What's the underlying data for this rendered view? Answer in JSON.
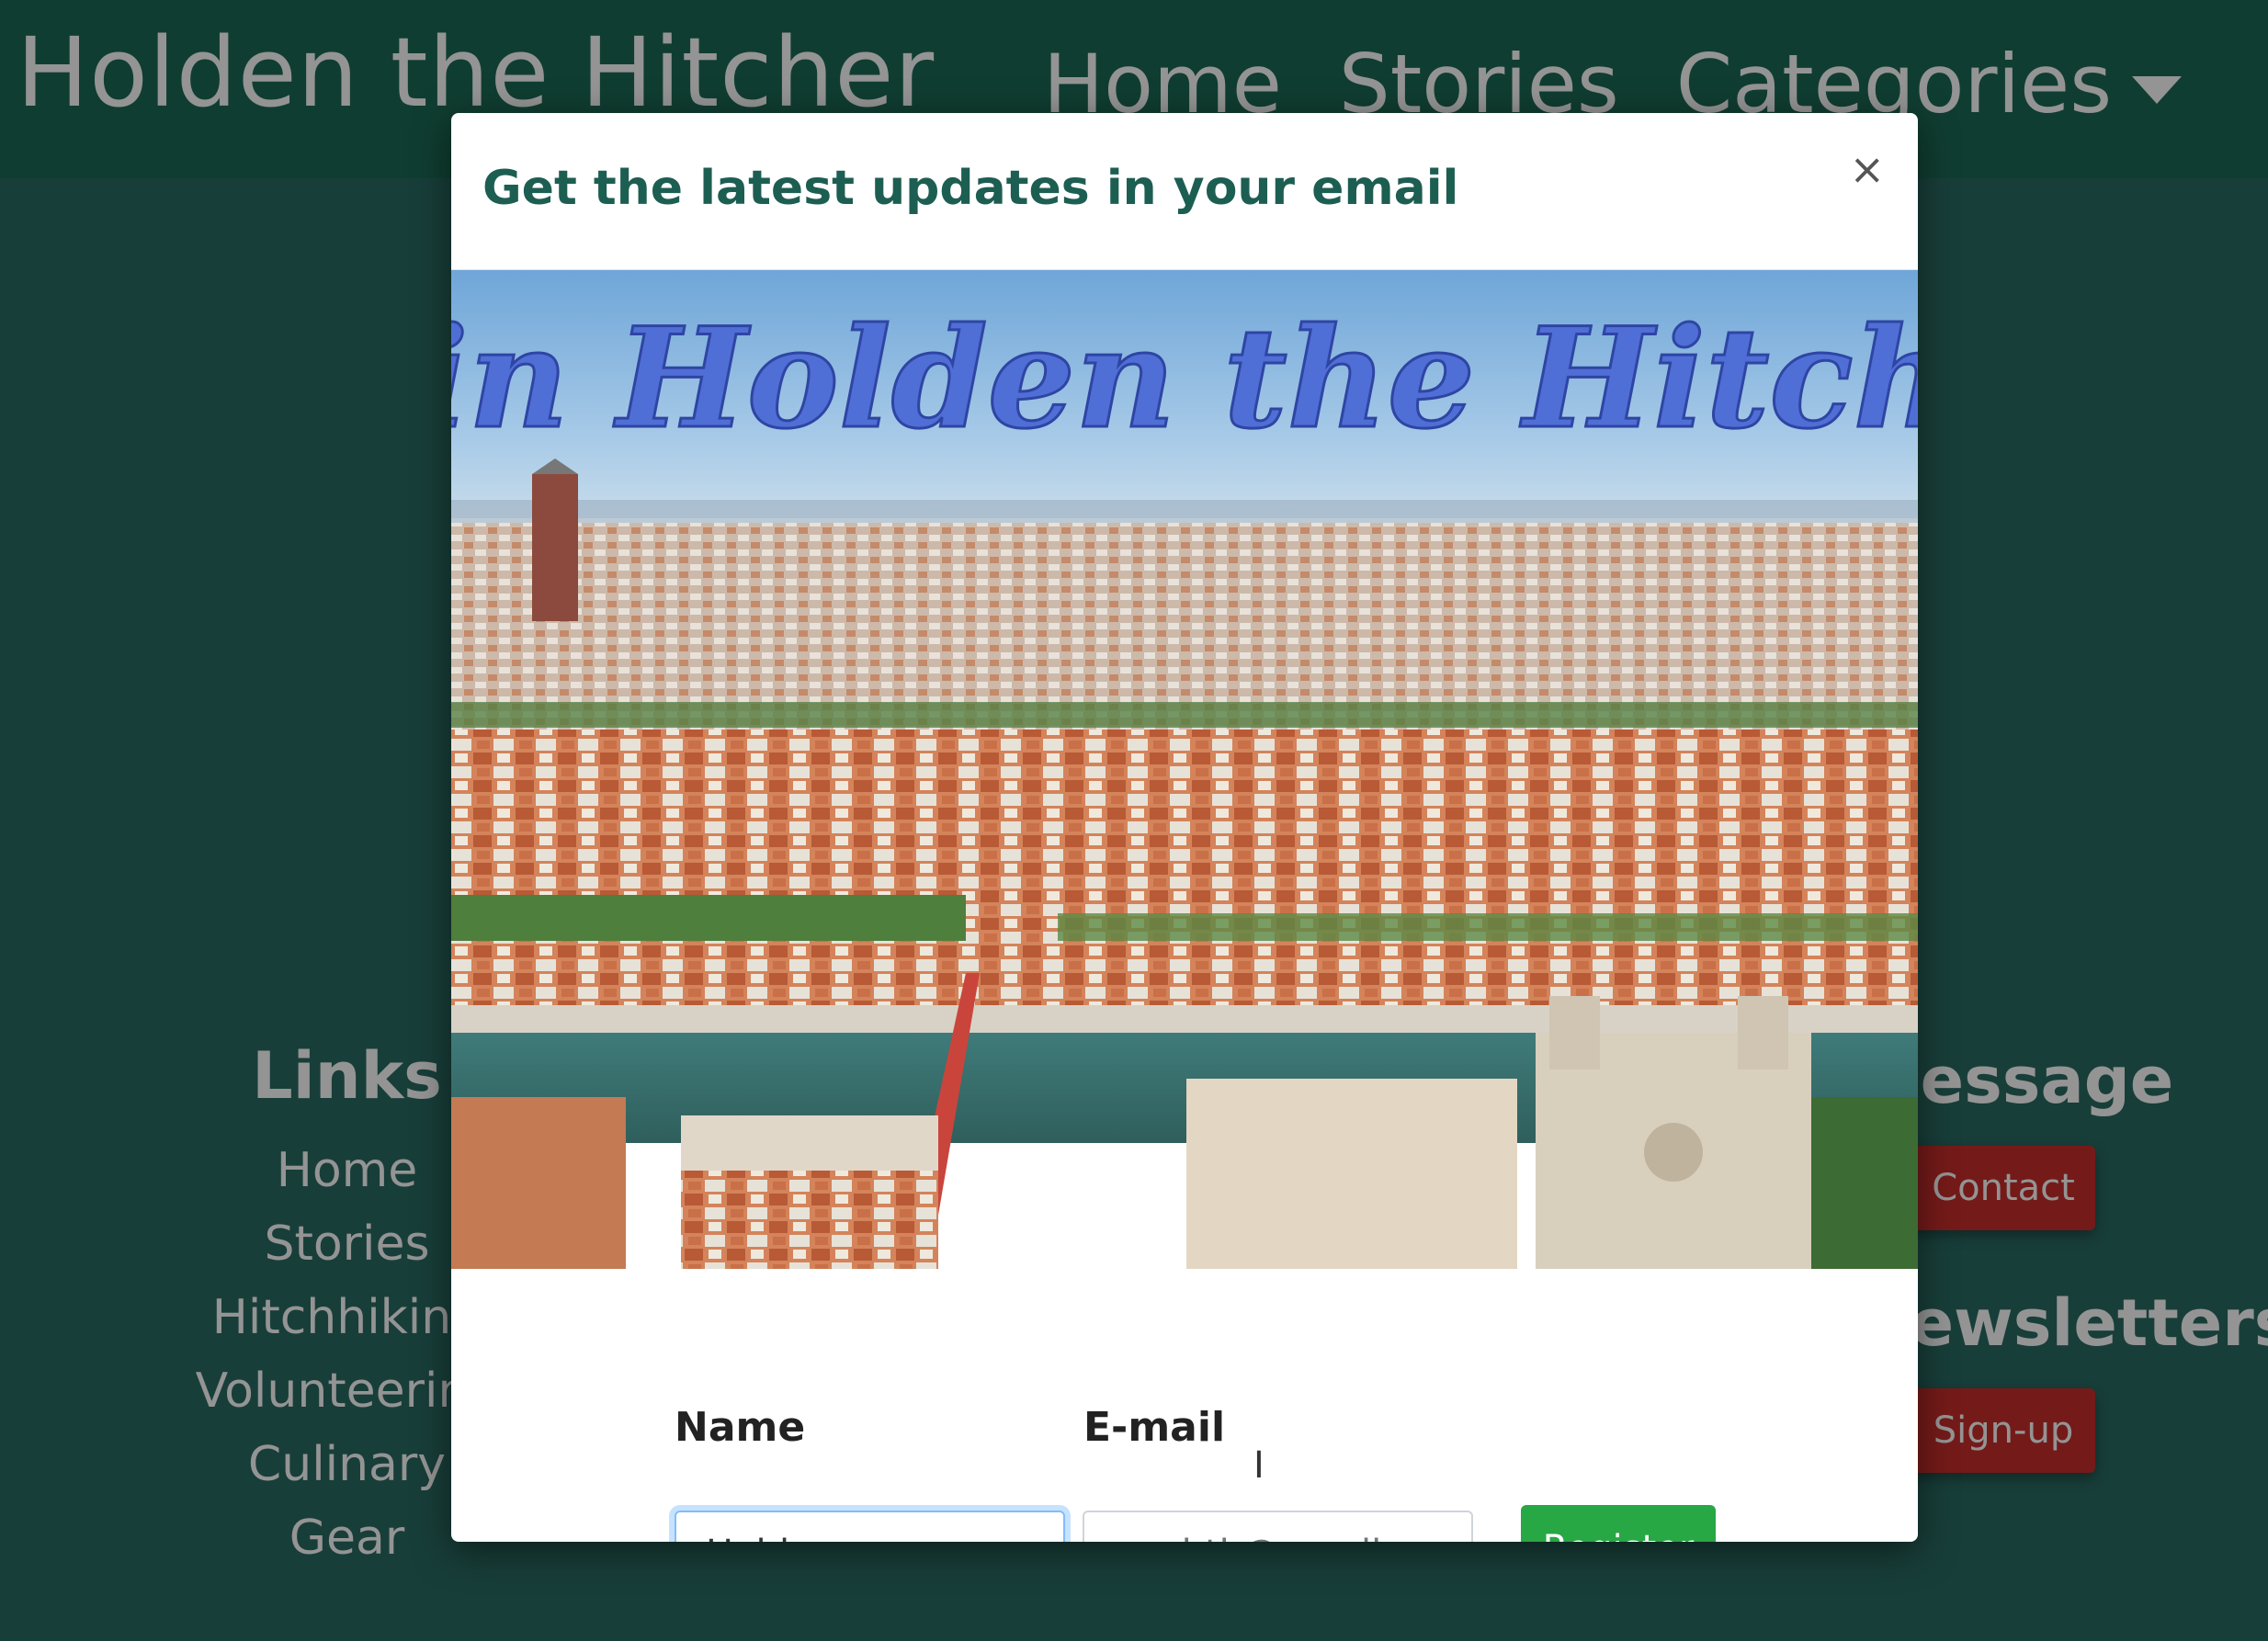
{
  "site": {
    "brand": "Holden the Hitcher",
    "nav": [
      "Home",
      "Stories",
      "Categories"
    ]
  },
  "footer": {
    "links_title": "Links",
    "links": [
      "Home",
      "Stories",
      "Hitchhiking",
      "Volunteering",
      "Culinary",
      "Gear"
    ],
    "message_title": "Message",
    "contact_label": "Contact",
    "newsletters_title": "Newsletters",
    "signup_label": "Sign-up"
  },
  "modal": {
    "title": "Get the latest updates in your email",
    "close_label": "×",
    "banner_text": "Join Holden the Hitcher",
    "name_label": "Name",
    "email_label": "E-mail",
    "name_value": "Holden",
    "email_placeholder": "ex: hth@gmail.com",
    "register_label": "Register"
  },
  "colors": {
    "navbar": "#1d6a55",
    "page_bg": "#2a6b63",
    "modal_title": "#1d5e52",
    "register_button": "#28a745",
    "red_button": "#c9302c",
    "banner_text": "#5a7fe0"
  }
}
